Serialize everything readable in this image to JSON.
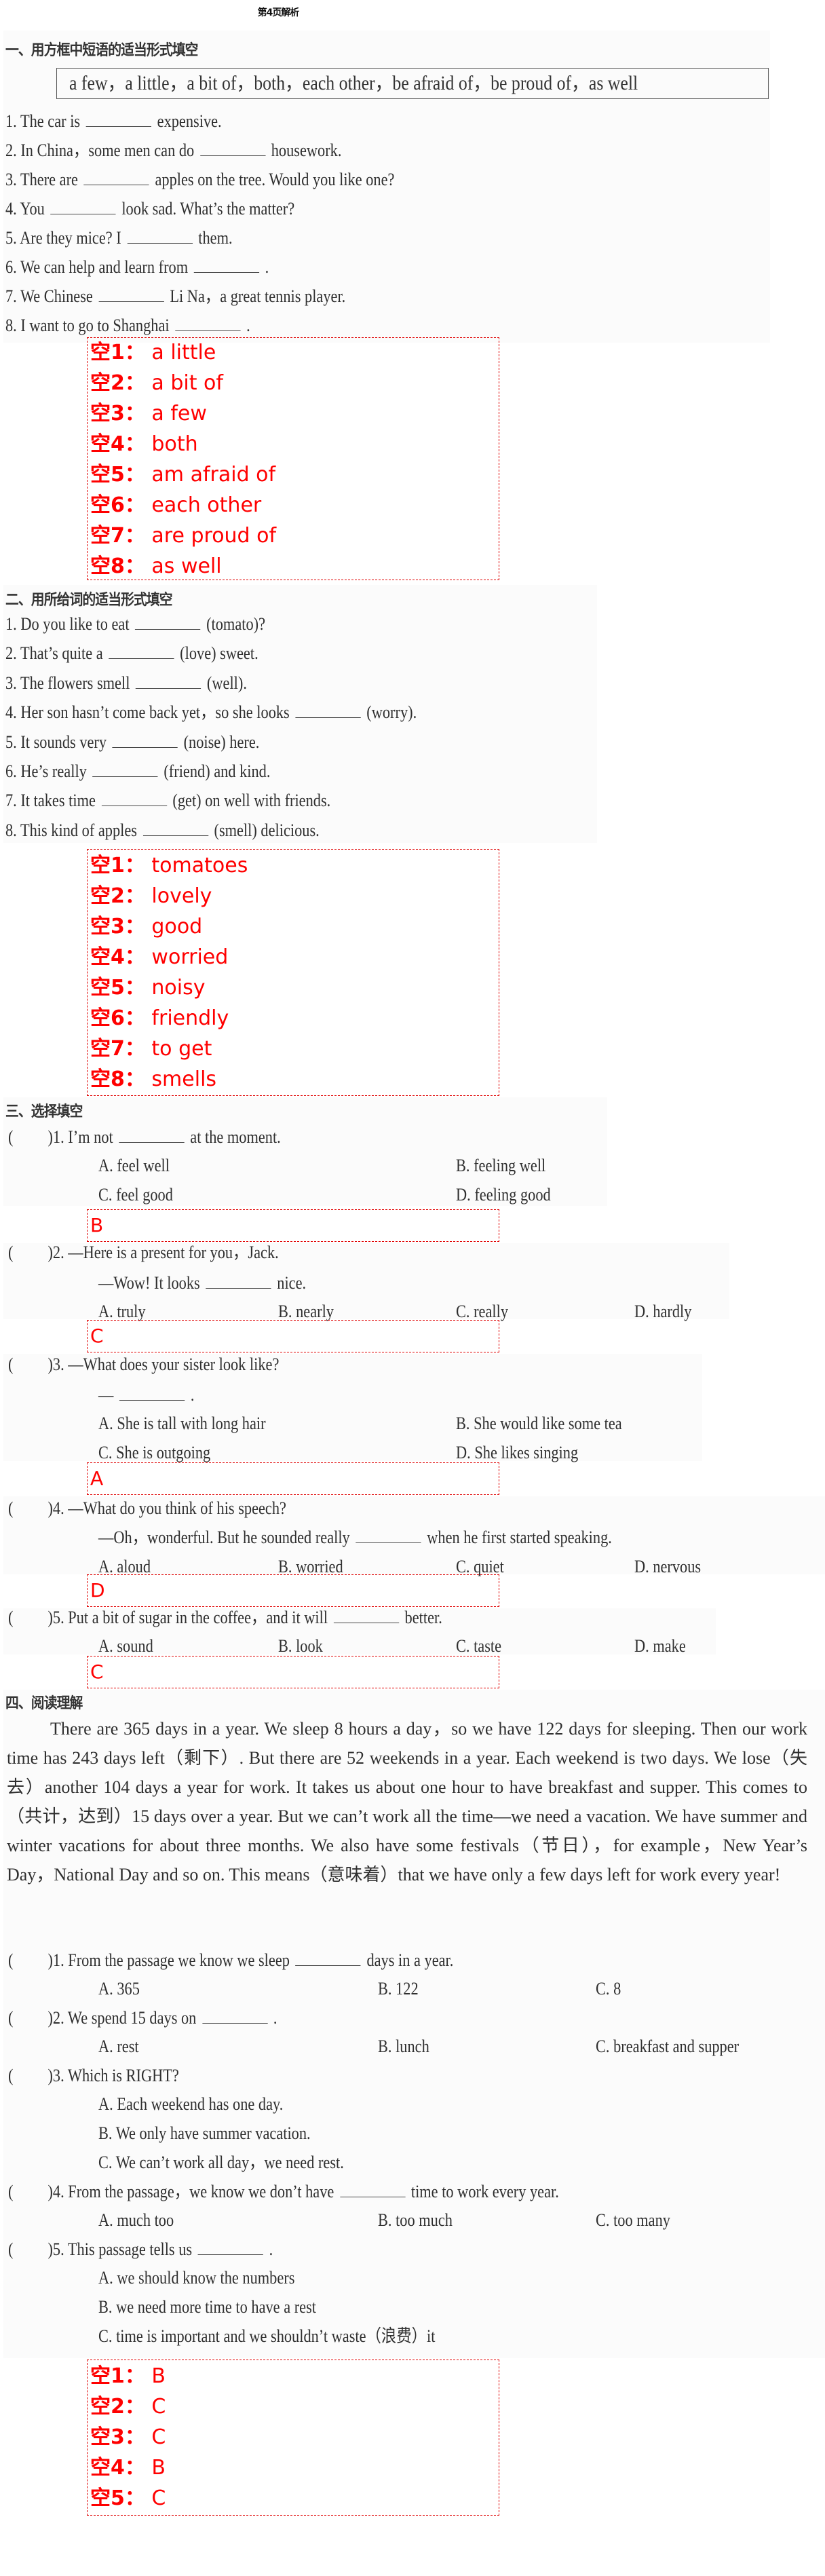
{
  "page_title": "第4页解析",
  "section1": {
    "heading": "一、用方框中短语的适当形式填空",
    "phrase_box": "a few，a little，a bit of，both，each other，be afraid of，be proud of，as well",
    "questions": [
      {
        "num": "1.",
        "before": "The car is",
        "after": "expensive."
      },
      {
        "num": "2.",
        "before": "In China，some men can do",
        "after": "housework."
      },
      {
        "num": "3.",
        "before": "There are",
        "after": "apples on the tree. Would you like one?"
      },
      {
        "num": "4.",
        "before": "You",
        "after": "look sad. What’s the matter?"
      },
      {
        "num": "5.",
        "before": "Are they mice? I",
        "after": "them."
      },
      {
        "num": "6.",
        "before": "We can help and learn from",
        "after": "."
      },
      {
        "num": "7.",
        "before": "We Chinese",
        "after": "Li Na，a great tennis player."
      },
      {
        "num": "8.",
        "before": "I want to go to Shanghai",
        "after": "."
      }
    ],
    "answers": [
      {
        "key": "空1：",
        "value": "a little"
      },
      {
        "key": "空2：",
        "value": "a bit of"
      },
      {
        "key": "空3：",
        "value": "a few"
      },
      {
        "key": "空4：",
        "value": "both"
      },
      {
        "key": "空5：",
        "value": "am afraid of"
      },
      {
        "key": "空6：",
        "value": "each other"
      },
      {
        "key": "空7：",
        "value": "are proud of"
      },
      {
        "key": "空8：",
        "value": "as well"
      }
    ]
  },
  "section2": {
    "heading": "二、用所给词的适当形式填空",
    "questions": [
      {
        "num": "1.",
        "before": "Do you like to eat",
        "after": "(tomato)?"
      },
      {
        "num": "2.",
        "before": "That’s quite a",
        "after": "(love) sweet."
      },
      {
        "num": "3.",
        "before": "The flowers smell",
        "after": "(well)."
      },
      {
        "num": "4.",
        "before": "Her son hasn’t come back yet，so she looks",
        "after": "(worry)."
      },
      {
        "num": "5.",
        "before": "It sounds very",
        "after": "(noise) here."
      },
      {
        "num": "6.",
        "before": "He’s really",
        "after": "(friend) and kind."
      },
      {
        "num": "7.",
        "before": "It takes time",
        "after": "(get) on well with friends."
      },
      {
        "num": "8.",
        "before": "This kind of apples",
        "after": "(smell) delicious."
      }
    ],
    "answers": [
      {
        "key": "空1：",
        "value": "tomatoes"
      },
      {
        "key": "空2：",
        "value": "lovely"
      },
      {
        "key": "空3：",
        "value": "good"
      },
      {
        "key": "空4：",
        "value": "worried"
      },
      {
        "key": "空5：",
        "value": "noisy"
      },
      {
        "key": "空6：",
        "value": "friendly"
      },
      {
        "key": "空7：",
        "value": "to get"
      },
      {
        "key": "空8：",
        "value": "smells"
      }
    ]
  },
  "section3": {
    "heading": "三、选择填空",
    "questions": [
      {
        "num": ")1.",
        "stem_before": "I’m not",
        "stem_after": "at the moment.",
        "options": [
          "A. feel well",
          "B. feeling well",
          "C. feel good",
          "D. feeling good"
        ],
        "answer": "B"
      },
      {
        "num": ")2.",
        "stem": "—Here is a present for you，Jack.",
        "sub_before": "—Wow! It looks",
        "sub_after": "nice.",
        "options": [
          "A. truly",
          "B. nearly",
          "C. really",
          "D. hardly"
        ],
        "answer": "C"
      },
      {
        "num": ")3.",
        "stem": "—What does your sister look like?",
        "sub_before": "—",
        "sub_after": ".",
        "options": [
          "A. She is tall with long hair",
          "B. She would like some tea",
          "C. She is outgoing",
          "D. She likes singing"
        ],
        "answer": "A"
      },
      {
        "num": ")4.",
        "stem": "—What do you think of his speech?",
        "sub_before": "—Oh，wonderful. But he sounded really",
        "sub_after": "when he first started speaking.",
        "options": [
          "A. aloud",
          "B. worried",
          "C. quiet",
          "D. nervous"
        ],
        "answer": "D"
      },
      {
        "num": ")5.",
        "stem_before": "Put a bit of sugar in the coffee，and it will",
        "stem_after": "better.",
        "options": [
          "A. sound",
          "B. look",
          "C. taste",
          "D. make"
        ],
        "answer": "C"
      }
    ]
  },
  "section4": {
    "heading": "四、阅读理解",
    "passage": "There are 365 days in a year. We sleep 8 hours a day，so we have 122 days for sleeping. Then our work time has 243 days left（剩下）. But there are 52 weekends in a year. Each weekend is two days. We lose（失去）another 104 days a year for work. It takes us about one hour to have breakfast and supper. This comes to（共计，达到）15 days over a year. But we can’t work all the time—we need a vacation. We have summer and winter vacations for about three months. We also have some festivals（节日），for example，New Year’s Day，National Day and so on. This means（意味着）that we have only a few days left for work every year!",
    "questions": [
      {
        "num": ")1.",
        "stem_before": "From the passage we know we sleep",
        "stem_after": "days in a year.",
        "options": [
          "A. 365",
          "B. 122",
          "C. 8"
        ]
      },
      {
        "num": ")2.",
        "stem_before": "We spend 15 days on",
        "stem_after": ".",
        "options": [
          "A. rest",
          "B. lunch",
          "C. breakfast and supper"
        ]
      },
      {
        "num": ")3.",
        "stem": "Which is RIGHT?",
        "options": [
          "A. Each weekend has one day.",
          "B. We only have summer vacation.",
          "C. We can’t work all day，we need rest."
        ]
      },
      {
        "num": ")4.",
        "stem_before": "From the passage，we know we don’t have",
        "stem_after": "time to work every year.",
        "options": [
          "A. much too",
          "B. too much",
          "C. too many"
        ]
      },
      {
        "num": ")5.",
        "stem_before": "This passage tells us",
        "stem_after": ".",
        "options": [
          "A. we should know the numbers",
          "B. we need more time to have a rest",
          "C. time is important and we shouldn’t waste（浪费）it"
        ]
      }
    ],
    "answers": [
      {
        "key": "空1：",
        "value": "B"
      },
      {
        "key": "空2：",
        "value": "C"
      },
      {
        "key": "空3：",
        "value": "C"
      },
      {
        "key": "空4：",
        "value": "B"
      },
      {
        "key": "空5：",
        "value": "C"
      }
    ]
  },
  "colors": {
    "answer_red": "#ff0000",
    "scan_bg": "#fbfbfb",
    "text": "#2f2f2f"
  }
}
